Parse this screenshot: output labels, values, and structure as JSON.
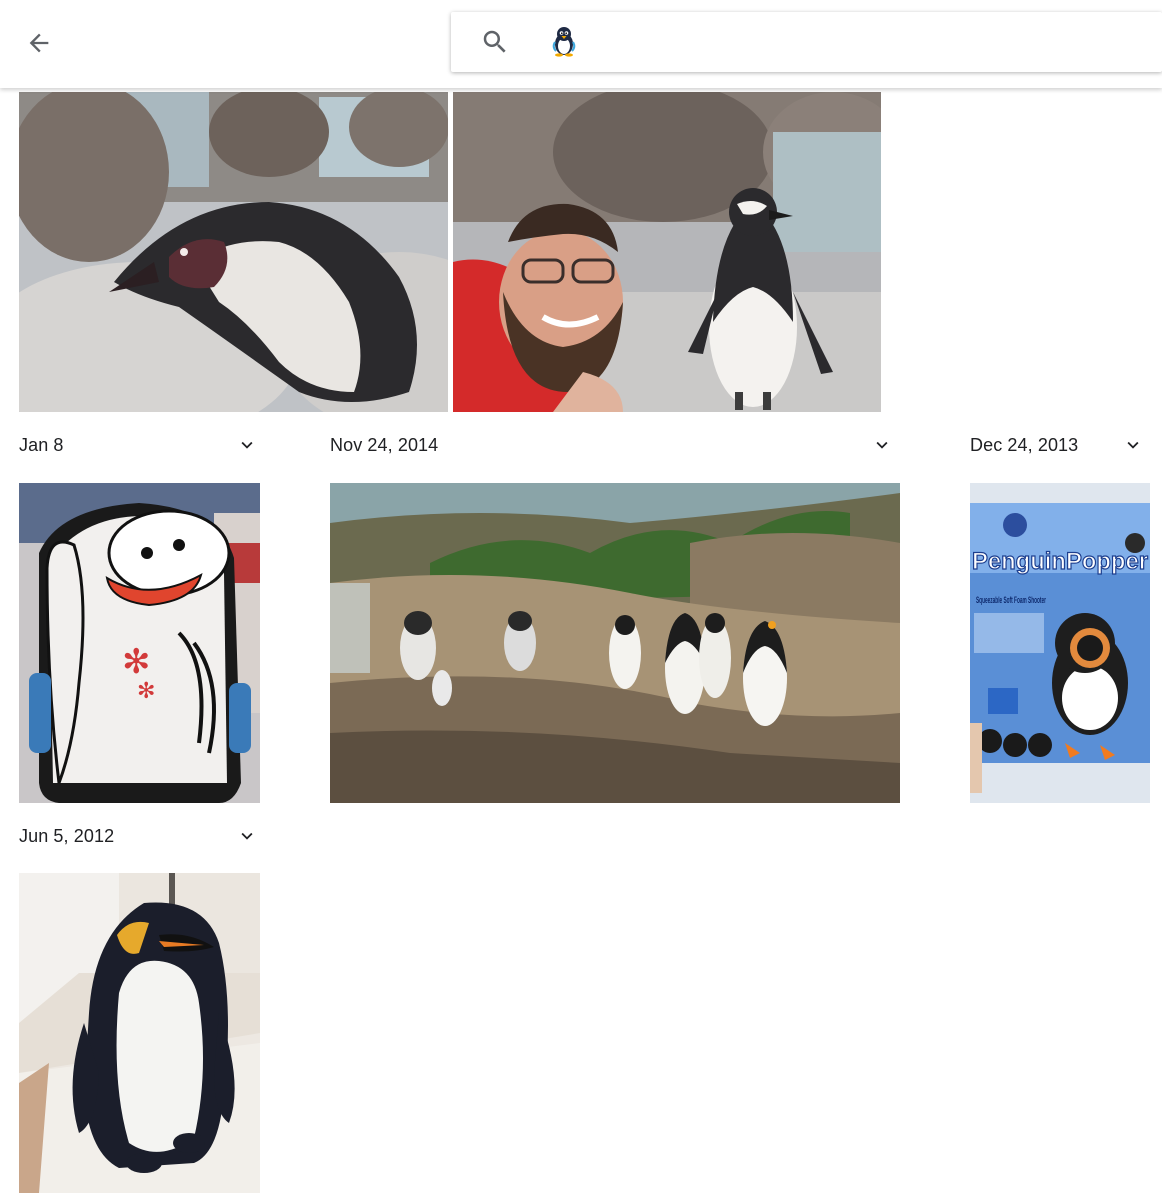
{
  "toolbar": {
    "back_icon": "arrow-back-icon",
    "search": {
      "icon": "search-icon",
      "query_icon": "penguin-emoji-icon",
      "query_text": ""
    }
  },
  "sections": [
    {
      "date": "Jan 8",
      "chevron_icon": "chevron-down-icon"
    },
    {
      "date": "Nov 24, 2014",
      "chevron_icon": "chevron-down-icon"
    },
    {
      "date": "Dec 24, 2013",
      "chevron_icon": "chevron-down-icon"
    },
    {
      "date": "Jun 5, 2012",
      "chevron_icon": "chevron-down-icon"
    }
  ],
  "photos": {
    "penguin_closeup": "penguin photo",
    "selfie_with_penguin": "selfie with penguin photo",
    "penguin_sled": "penguin sled photo",
    "penguin_exhibit": "penguin exhibit photo",
    "penguin_popper_package": {
      "brand_text": "PenguinPopper",
      "subtitle_text": "Squeezable Soft Foam Shooter"
    },
    "penguin_plush": "penguin plush photo"
  },
  "colors": {
    "text": "#202124",
    "icon": "#5f6368",
    "background": "#ffffff"
  }
}
